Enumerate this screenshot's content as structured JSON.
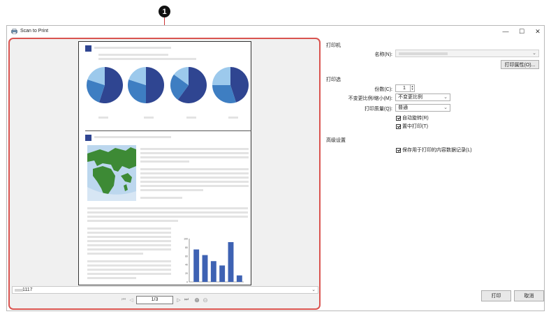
{
  "callout": {
    "number": "1"
  },
  "window": {
    "title": "Scan to Print",
    "minimize": "—",
    "maximize": "☐",
    "close": "✕"
  },
  "preview": {
    "file_select_value": "1117",
    "page_indicator": "1/3",
    "nav": {
      "first": "⏮",
      "prev": "◁",
      "next": "▷",
      "last": "⏭",
      "zoom_in": "⊕",
      "zoom_out": "⊖"
    }
  },
  "chart_data": {
    "type": "bar",
    "values": [
      75,
      62,
      48,
      38,
      92,
      15
    ],
    "ylim": [
      0,
      100
    ],
    "y_ticks": [
      "100",
      "80",
      "60",
      "40",
      "20",
      "0"
    ],
    "color": "#3e62b3"
  },
  "pies": [
    {
      "slices": [
        0.55,
        0.25,
        0.2
      ]
    },
    {
      "slices": [
        0.5,
        0.3,
        0.2
      ]
    },
    {
      "slices": [
        0.6,
        0.25,
        0.15
      ]
    },
    {
      "slices": [
        0.45,
        0.3,
        0.25
      ]
    }
  ],
  "colors": {
    "callout_border": "#d9534f",
    "pie_dark": "#2f4591",
    "pie_mid": "#3e7ec2",
    "pie_light": "#9cc9ec",
    "map_green": "#3d8a35",
    "map_sea": "#bcd7ee"
  },
  "settings": {
    "printer_section": "打印机",
    "name_label": "名称(N):",
    "print_properties_button": "打印属性(O)...",
    "print_section": "打印选",
    "copies_label": "份数(C):",
    "copies_value": "1",
    "scale_label": "不变更比例/缩小(M):",
    "scale_value": "不变更比例",
    "quality_label": "打印质量(Q):",
    "quality_value": "普通",
    "auto_rotate_label": "自动旋转(R)",
    "center_label": "置中打印(T)",
    "advanced_section": "高级设置",
    "save_data_label": "保存用于打印的内容数据记录(L)",
    "print_button": "打印",
    "cancel_button": "取消"
  }
}
